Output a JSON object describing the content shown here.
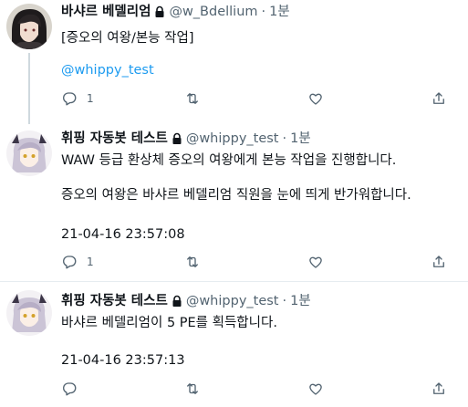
{
  "tweets": [
    {
      "name": "바샤르 베델리엄",
      "handle": "@w_Bdellium",
      "separator": "·",
      "time": "1분",
      "lines": [
        "[증오의 여왕/본능 작업]"
      ],
      "mention": "@whippy_test",
      "reply_count": "1"
    },
    {
      "name": "휘핑 자동봇 테스트",
      "handle": "@whippy_test",
      "separator": "·",
      "time": "1분",
      "lines": [
        "WAW 등급 환상체 증오의 여왕에게 본능 작업을 진행합니다.",
        "증오의 여왕은 바샤르 베델리엄 직원을 눈에 띄게 반가워합니다."
      ],
      "timestamp": "21-04-16 23:57:08",
      "reply_count": "1"
    },
    {
      "name": "휘핑 자동봇 테스트",
      "handle": "@whippy_test",
      "separator": "·",
      "time": "1분",
      "lines": [
        "바샤르 베델리엄이 5 PE를 획득합니다."
      ],
      "timestamp": "21-04-16 23:57:13",
      "reply_count": ""
    }
  ],
  "icons": {
    "reply": "reply-icon",
    "retweet": "retweet-icon",
    "like": "heart-icon",
    "share": "share-icon",
    "lock": "lock-icon"
  },
  "colors": {
    "text": "#0f1419",
    "secondary": "#536471",
    "mention": "#1d9bf0",
    "thread_line": "#cfd9de"
  }
}
